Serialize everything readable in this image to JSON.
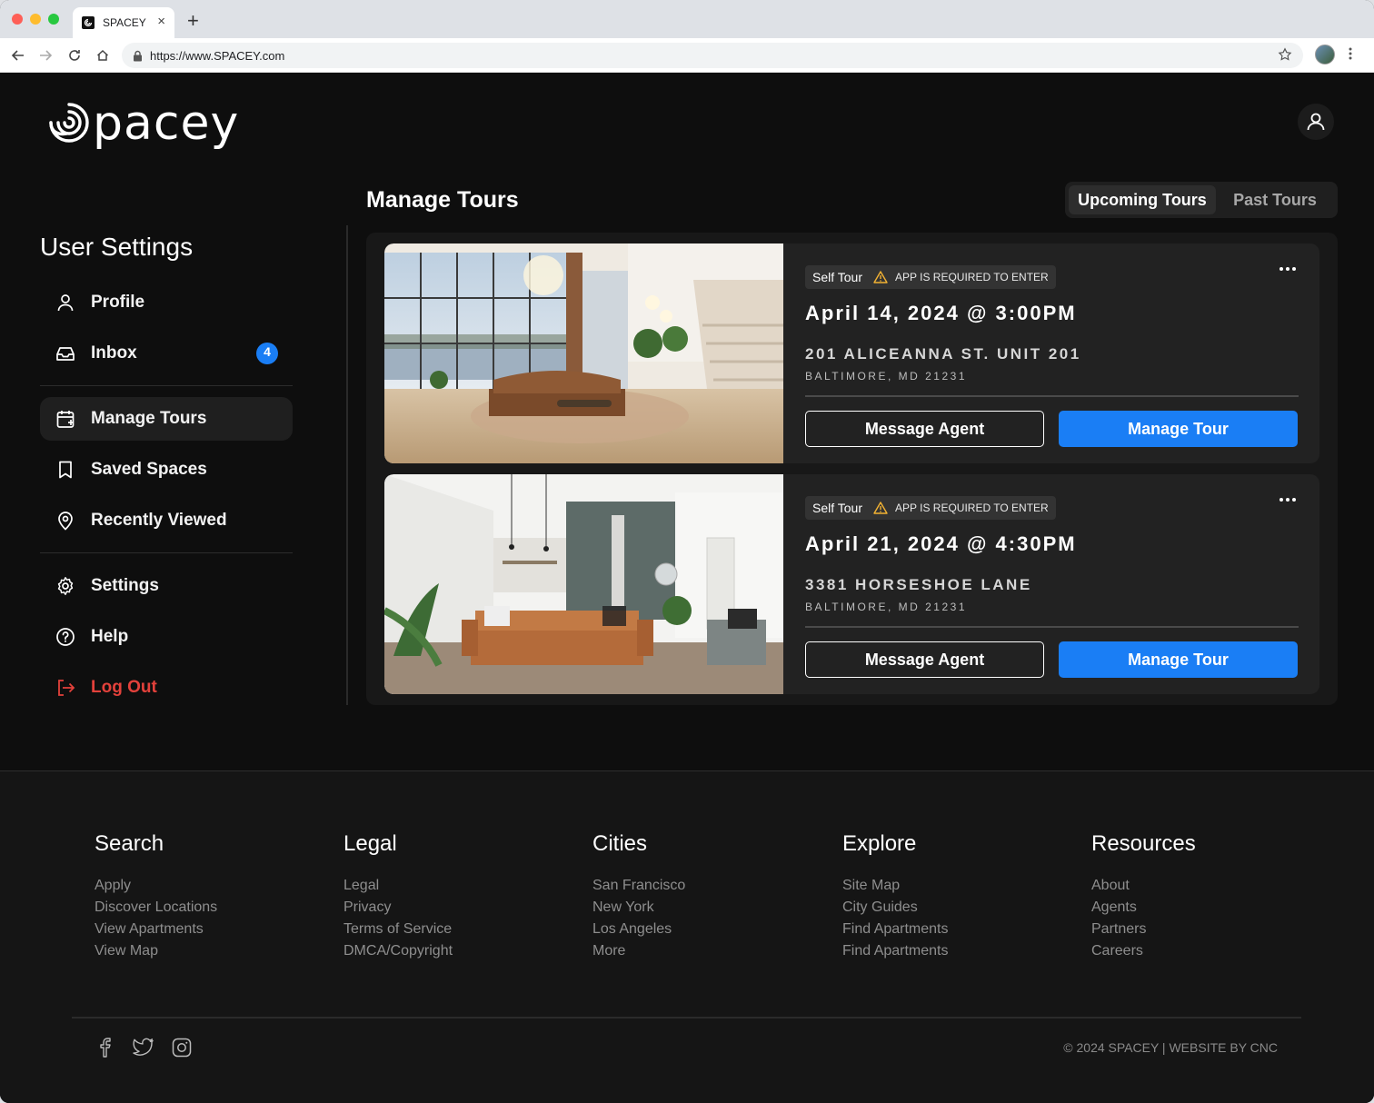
{
  "browser": {
    "tab_title": "SPACEY",
    "url": "https://www.SPACEY.com"
  },
  "header": {
    "logo_text": "pacey"
  },
  "sidebar": {
    "title": "User Settings",
    "items": [
      {
        "label": "Profile",
        "icon": "user-icon"
      },
      {
        "label": "Inbox",
        "icon": "inbox-icon",
        "badge": "4"
      },
      {
        "label": "Manage Tours",
        "icon": "calendar-icon",
        "active": true
      },
      {
        "label": "Saved Spaces",
        "icon": "bookmark-icon"
      },
      {
        "label": "Recently Viewed",
        "icon": "location-pin-icon"
      },
      {
        "label": "Settings",
        "icon": "gear-icon"
      },
      {
        "label": "Help",
        "icon": "help-circle-icon"
      },
      {
        "label": "Log Out",
        "icon": "logout-icon"
      }
    ]
  },
  "main": {
    "title": "Manage Tours",
    "tabs": [
      {
        "label": "Upcoming Tours",
        "active": true
      },
      {
        "label": "Past Tours",
        "active": false
      }
    ],
    "tours": [
      {
        "type": "Self Tour",
        "warning": "APP IS REQUIRED TO ENTER",
        "date": "April 14, 2024 @ 3:00PM",
        "address": "201 ALICEANNA ST. UNIT 201",
        "city": "BALTIMORE, MD 21231",
        "message_label": "Message Agent",
        "manage_label": "Manage Tour"
      },
      {
        "type": "Self Tour",
        "warning": "APP IS REQUIRED TO ENTER",
        "date": "April 21, 2024 @ 4:30PM",
        "address": "3381 HORSESHOE LANE",
        "city": "BALTIMORE, MD 21231",
        "message_label": "Message Agent",
        "manage_label": "Manage Tour"
      }
    ]
  },
  "footer": {
    "columns": [
      {
        "heading": "Search",
        "links": [
          "Apply",
          "Discover Locations",
          "View Apartments",
          "View Map"
        ]
      },
      {
        "heading": "Legal",
        "links": [
          "Legal",
          "Privacy",
          "Terms of Service",
          "DMCA/Copyright"
        ]
      },
      {
        "heading": "Cities",
        "links": [
          "San Francisco",
          "New York",
          "Los Angeles",
          "More"
        ]
      },
      {
        "heading": "Explore",
        "links": [
          "Site Map",
          "City Guides",
          "Find Apartments",
          "Find Apartments"
        ]
      },
      {
        "heading": "Resources",
        "links": [
          "About",
          "Agents",
          "Partners",
          "Careers"
        ]
      }
    ],
    "copyright": "© 2024 SPACEY | WEBSITE BY CNC",
    "socials": [
      "facebook-icon",
      "twitter-icon",
      "instagram-icon"
    ]
  },
  "colors": {
    "accent": "#1a7ef5",
    "logout": "#e3413b",
    "background": "#0e0e0e"
  }
}
